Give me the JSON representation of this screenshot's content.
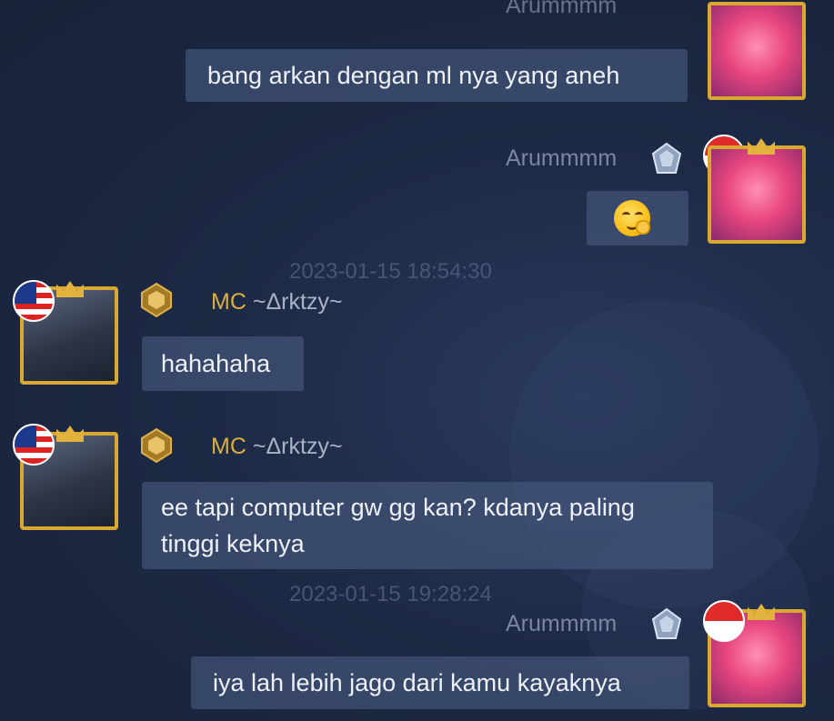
{
  "messages": [
    {
      "sender": "Arummmm",
      "text": "bang arkan dengan ml nya yang aneh"
    },
    {
      "sender": "Arummmm",
      "emoji": "🤭"
    },
    {
      "timestamp": "2023-01-15 18:54:30"
    },
    {
      "sender_tag": "MC",
      "sender_name": "~Δrktzy~",
      "text": "hahahaha"
    },
    {
      "sender_tag": "MC",
      "sender_name": "~Δrktzy~",
      "text": "ee tapi computer gw gg kan? kdanya paling tinggi keknya"
    },
    {
      "timestamp": "2023-01-15 19:28:24"
    },
    {
      "sender": "Arummmm",
      "text": "iya lah lebih jago dari kamu kayaknya"
    }
  ],
  "colors": {
    "background": "#1d2a45",
    "bubble": "#48597f",
    "name_tag": "#d9b040",
    "frame": "#d8a830"
  },
  "icons": {
    "self_rank": "diamond-rank-icon",
    "other_rank": "gold-rank-icon",
    "self_flag": "indonesia-flag-icon",
    "other_flag": "malaysia-flag-icon"
  }
}
